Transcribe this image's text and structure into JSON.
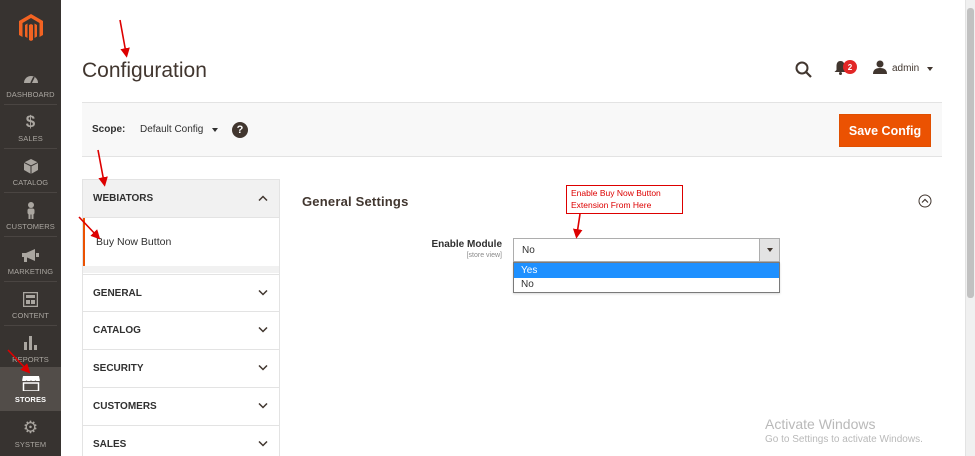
{
  "admin_menu": {
    "items": [
      {
        "label": "DASHBOARD",
        "icon": "speedometer-icon"
      },
      {
        "label": "SALES",
        "icon": "dollar-icon"
      },
      {
        "label": "CATALOG",
        "icon": "cube-icon"
      },
      {
        "label": "CUSTOMERS",
        "icon": "person-icon"
      },
      {
        "label": "MARKETING",
        "icon": "megaphone-icon"
      },
      {
        "label": "CONTENT",
        "icon": "layout-icon"
      },
      {
        "label": "REPORTS",
        "icon": "bar-chart-icon"
      },
      {
        "label": "STORES",
        "icon": "storefront-icon",
        "active": true
      },
      {
        "label": "SYSTEM",
        "icon": "gear-icon"
      }
    ]
  },
  "header": {
    "title": "Configuration",
    "notifications_count": "2",
    "user_name": "admin"
  },
  "scope": {
    "label": "Scope:",
    "value": "Default Config",
    "save_label": "Save Config"
  },
  "tabs": {
    "group_label": "WEBIATORS",
    "active_item": "Buy Now Button",
    "sections": [
      "GENERAL",
      "CATALOG",
      "SECURITY",
      "CUSTOMERS",
      "SALES"
    ]
  },
  "section": {
    "title": "General Settings",
    "field_label": "Enable Module",
    "field_scope": "[store view]",
    "select_value": "No",
    "options": [
      "Yes",
      "No"
    ],
    "highlighted_option": "Yes"
  },
  "annotation": {
    "line1": "Enable Buy Now Button",
    "line2": "Extension From Here"
  },
  "watermark": {
    "title": "Activate Windows",
    "subtitle": "Go to Settings to activate Windows."
  },
  "colors": {
    "accent": "#eb5202",
    "sidebar_bg": "#373330",
    "annotation": "#dd0000",
    "option_highlight": "#1e90ff"
  }
}
